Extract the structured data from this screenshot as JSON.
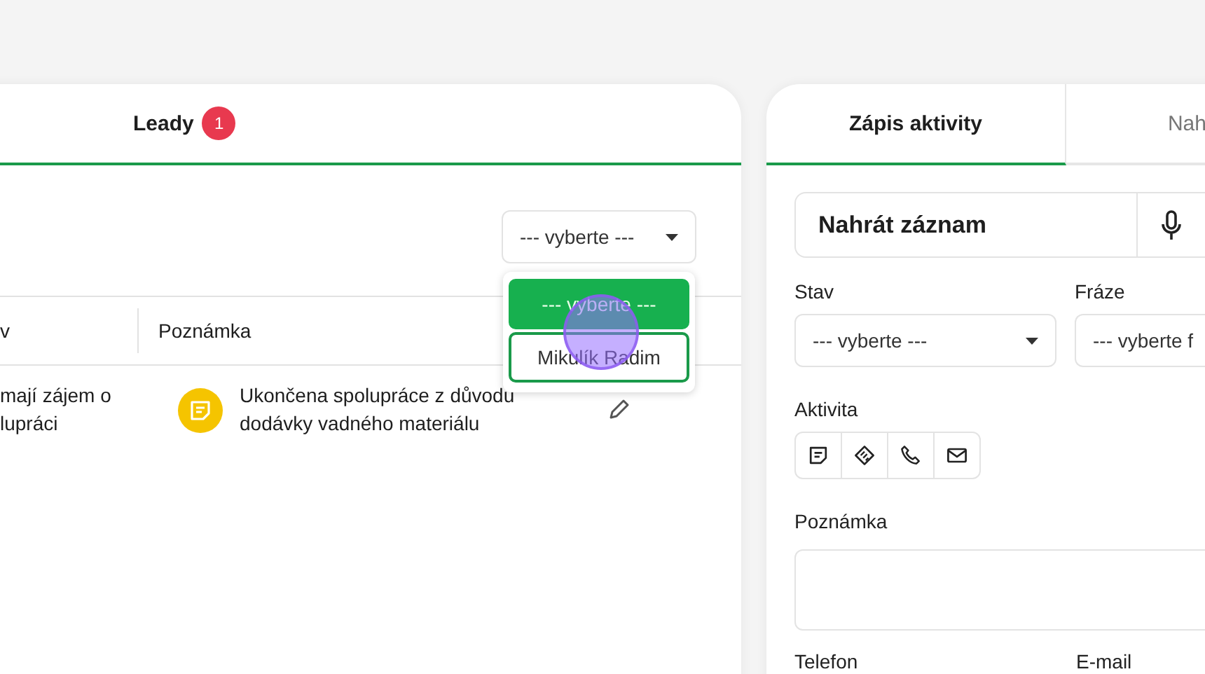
{
  "leads_panel": {
    "tabs": [
      {
        "label": "Leady",
        "badge": "1"
      }
    ],
    "filter_select": {
      "value": "--- vyberte ---",
      "expanded": true,
      "options": [
        {
          "label": "--- vyberte ---",
          "selected": true,
          "hovered": false
        },
        {
          "label": "Mikulík Radim",
          "selected": false,
          "hovered": true
        }
      ]
    },
    "table": {
      "columns": [
        "v",
        "Poznámka"
      ],
      "rows": [
        {
          "column_1": [
            "mají zájem o",
            "lupráci"
          ],
          "note": "Ukončena spolupráce z důvodu dodávky vadného materiálu"
        }
      ]
    }
  },
  "activity_panel": {
    "tabs": [
      {
        "label": "Zápis aktivity",
        "selected": true
      },
      {
        "label": "Nah",
        "selected": false
      }
    ],
    "record_button": {
      "label": "Nahrát záznam"
    },
    "status_field": {
      "label": "Stav",
      "value": "--- vyberte ---"
    },
    "phrase_field": {
      "label": "Fráze",
      "value": "--- vyberte f"
    },
    "activity": {
      "label": "Aktivita",
      "buttons": [
        {
          "kind": "note"
        },
        {
          "kind": "handshake"
        },
        {
          "kind": "phone"
        },
        {
          "kind": "mail"
        }
      ]
    },
    "note_field": {
      "label": "Poznámka"
    },
    "contact_labels": [
      "Telefon",
      "E-mail"
    ]
  }
}
